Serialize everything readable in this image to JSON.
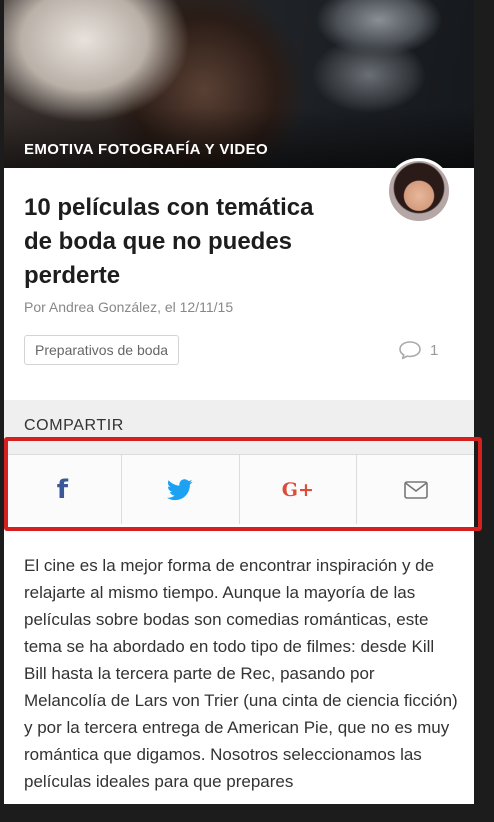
{
  "hero": {
    "category": "EMOTIVA FOTOGRAFÍA Y VIDEO"
  },
  "article": {
    "title": "10 películas con temática de boda que no puedes perderte",
    "byline": "Por Andrea González, el 12/11/15",
    "tag": "Preparativos de boda",
    "comment_count": "1",
    "body": "El cine es la mejor forma de encontrar inspiración y de relajarte al mismo tiempo. Aunque la mayoría de las películas sobre bodas son comedias románticas, este tema se ha abordado en todo tipo de filmes: desde Kill Bill hasta la tercera parte de Rec, pasando por Melancolía de Lars von Trier (una cinta de ciencia ficción) y por la tercera entrega de American Pie, que no es muy romántica que digamos. Nosotros seleccionamos las películas ideales para que prepares"
  },
  "share": {
    "label": "COMPARTIR",
    "buttons": [
      {
        "icon": "facebook-icon",
        "glyph": "f",
        "color": "#3b5998"
      },
      {
        "icon": "twitter-icon",
        "color": "#1da1f2"
      },
      {
        "icon": "google-plus-icon",
        "glyph": "G+",
        "color": "#dd4b39"
      },
      {
        "icon": "email-icon",
        "color": "#777777"
      }
    ]
  },
  "colors": {
    "highlight": "#d61f1f",
    "share_background": "#efefef"
  }
}
